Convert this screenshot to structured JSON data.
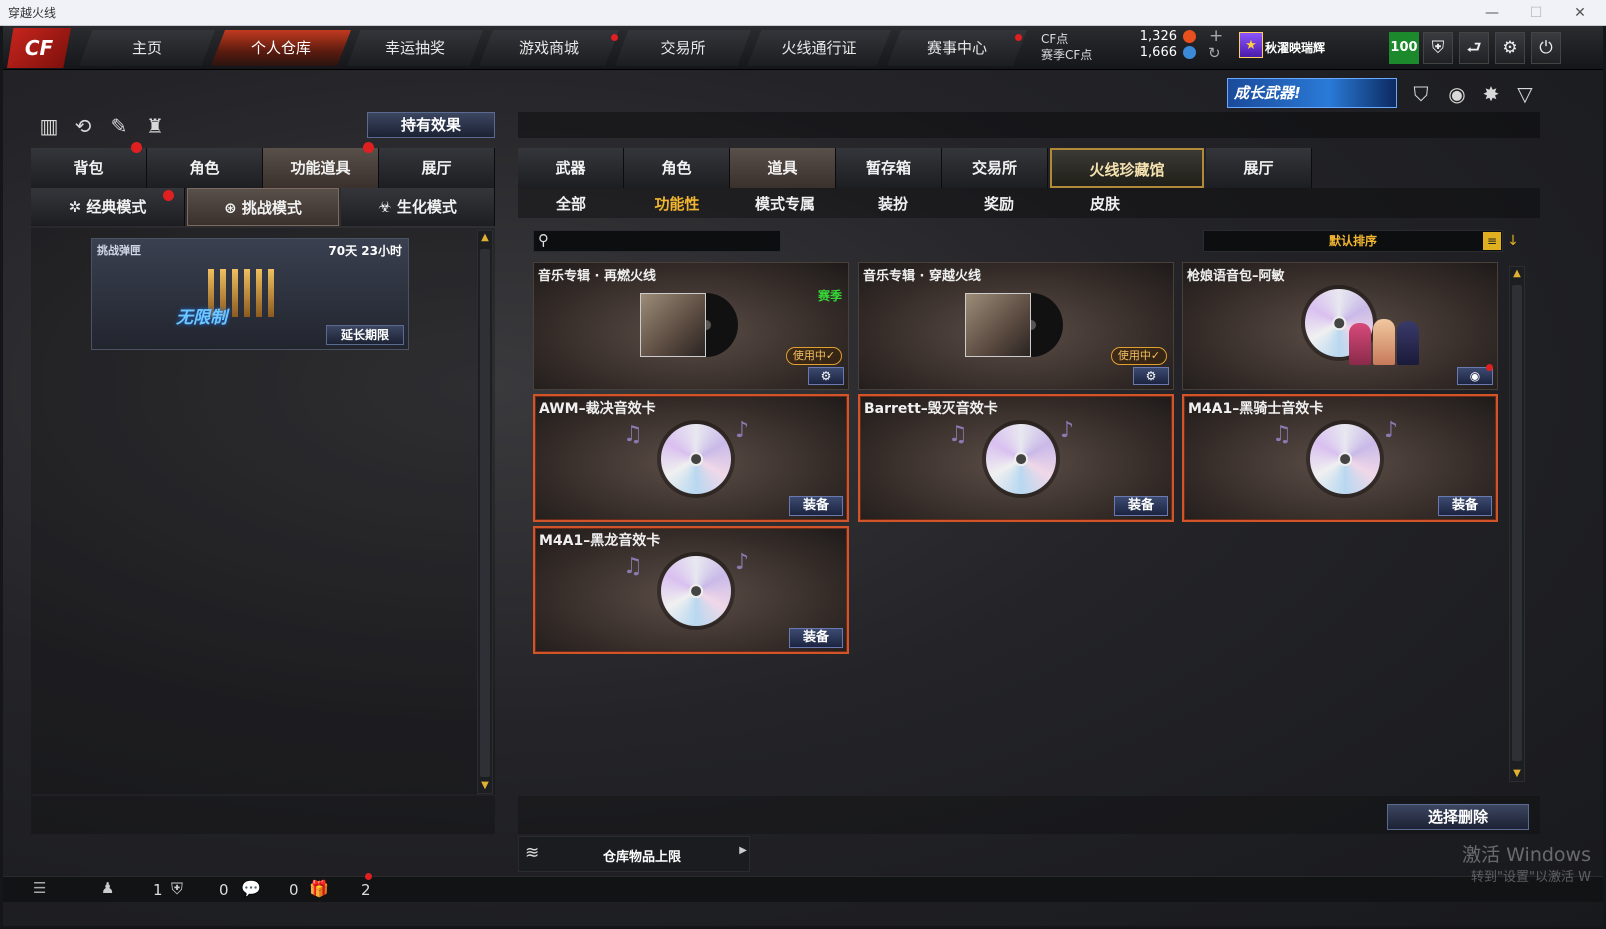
{
  "window": {
    "title": "穿越火线"
  },
  "nav": {
    "tabs": [
      {
        "label": "主页"
      },
      {
        "label": "个人仓库"
      },
      {
        "label": "幸运抽奖"
      },
      {
        "label": "游戏商城"
      },
      {
        "label": "交易所"
      },
      {
        "label": "火线通行证"
      },
      {
        "label": "赛事中心"
      }
    ]
  },
  "account": {
    "cf_label": "CF点",
    "cf_value": "1,326",
    "season_cf_label": "赛季CF点",
    "season_cf_value": "1,666",
    "username": "秋濯映瑞辉",
    "level": "100"
  },
  "left": {
    "hold_effect": "持有效果",
    "tabs": [
      "背包",
      "角色",
      "功能道具",
      "展厅"
    ],
    "modes": [
      "经典模式",
      "挑战模式",
      "生化模式"
    ],
    "box": {
      "title": "挑战弹匣",
      "duration": "70天 23小时",
      "art_text": "无限制",
      "extend": "延长期限"
    }
  },
  "right": {
    "banner": "成长武器!",
    "tabs": [
      "武器",
      "角色",
      "道具",
      "暂存箱",
      "交易所",
      "火线珍藏馆",
      "展厅"
    ],
    "subtabs": [
      "全部",
      "功能性",
      "模式专属",
      "装扮",
      "奖励",
      "皮肤"
    ],
    "sort_label": "默认排序",
    "items": [
      {
        "title": "音乐专辑 · 再燃火线",
        "season": "赛季",
        "status": "使用中✓"
      },
      {
        "title": "音乐专辑 · 穿越火线",
        "status": "使用中✓"
      },
      {
        "title": "枪娘语音包–阿敏"
      },
      {
        "title": "AWM–裁决音效卡",
        "action": "装备"
      },
      {
        "title": "Barrett–毁灭音效卡",
        "action": "装备"
      },
      {
        "title": "M4A1–黑骑士音效卡",
        "action": "装备"
      },
      {
        "title": "M4A1–黑龙音效卡",
        "action": "装备"
      }
    ],
    "select_delete": "选择删除",
    "storage_limit": "仓库物品上限"
  },
  "status_bar": {
    "counts": [
      "1",
      "0",
      "0",
      "2"
    ]
  },
  "watermark": {
    "line1": "激活 Windows",
    "line2": "转到\"设置\"以激活 W"
  }
}
